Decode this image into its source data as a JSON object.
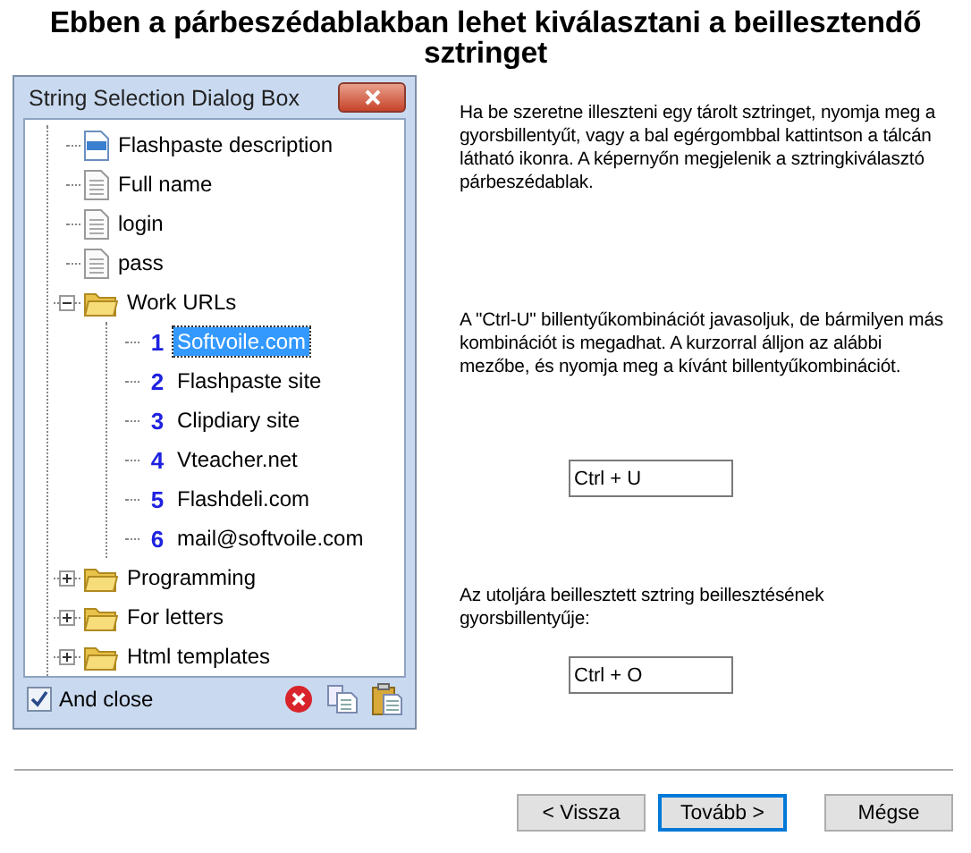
{
  "heading": "Ebben a párbeszédablakban lehet kiválasztani a beillesztendő sztringet",
  "dialog": {
    "title": "String Selection Dialog Box",
    "tree": [
      {
        "kind": "rtf",
        "label": "Flashpaste description",
        "selected": false
      },
      {
        "kind": "file",
        "label": "Full name",
        "selected": false
      },
      {
        "kind": "file",
        "label": "login",
        "selected": false
      },
      {
        "kind": "file",
        "label": "pass",
        "selected": false
      },
      {
        "kind": "folder",
        "label": "Work URLs",
        "selected": false,
        "expanded": true,
        "children": [
          {
            "kind": "link",
            "number": "1",
            "label": "Softvoile.com",
            "selected": true
          },
          {
            "kind": "link",
            "number": "2",
            "label": "Flashpaste site",
            "selected": false
          },
          {
            "kind": "link",
            "number": "3",
            "label": "Clipdiary site",
            "selected": false
          },
          {
            "kind": "link",
            "number": "4",
            "label": "Vteacher.net",
            "selected": false
          },
          {
            "kind": "link",
            "number": "5",
            "label": "Flashdeli.com",
            "selected": false
          },
          {
            "kind": "link",
            "number": "6",
            "label": "mail@softvoile.com",
            "selected": false
          }
        ]
      },
      {
        "kind": "folder",
        "label": "Programming",
        "selected": false,
        "expanded": false
      },
      {
        "kind": "folder",
        "label": "For letters",
        "selected": false,
        "expanded": false
      },
      {
        "kind": "folder",
        "label": "Html templates",
        "selected": false,
        "expanded": false
      }
    ],
    "and_close": {
      "label": "And close",
      "checked": true
    }
  },
  "paragraphs": [
    "Ha be szeretne illeszteni egy tárolt sztringet, nyomja meg a gyorsbillentyűt, vagy a bal egérgombbal kattintson a tálcán látható ikonra. A képernyőn megjelenik a sztringkiválasztó párbeszédablak.",
    "A \"Ctrl-U\" billentyűkombinációt javasoljuk, de bármilyen más kombinációt is megadhat. A kurzorral álljon az alábbi mezőbe, és nyomja meg a kívánt billentyűkombinációt.",
    "Az utoljára beillesztett sztring beillesztésének gyorsbillentyűje:"
  ],
  "hotkey_field": {
    "value": "Ctrl + U"
  },
  "last_hotkey_field": {
    "value": "Ctrl + O"
  },
  "buttons": [
    {
      "label": "< Vissza",
      "focused": false
    },
    {
      "label": "Tovább >",
      "focused": true
    },
    {
      "label": "Mégse",
      "focused": false
    }
  ]
}
